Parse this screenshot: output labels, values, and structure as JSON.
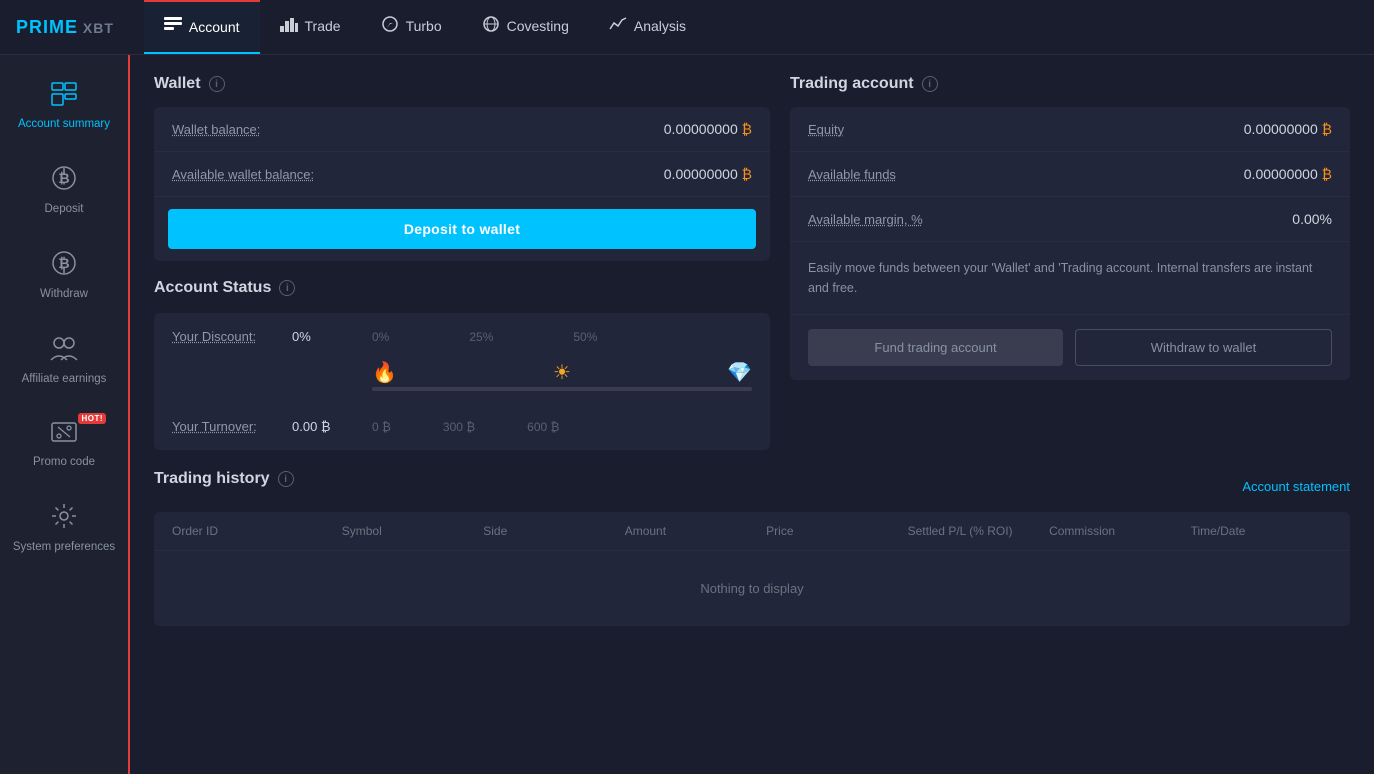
{
  "logo": {
    "prime": "PRIME",
    "xbt": " XBT"
  },
  "nav": {
    "items": [
      {
        "id": "account",
        "label": "Account",
        "icon": "🗂",
        "active": true
      },
      {
        "id": "trade",
        "label": "Trade",
        "icon": "📊",
        "active": false
      },
      {
        "id": "turbo",
        "label": "Turbo",
        "icon": "🔄",
        "active": false
      },
      {
        "id": "covesting",
        "label": "Covesting",
        "icon": "🌐",
        "active": false
      },
      {
        "id": "analysis",
        "label": "Analysis",
        "icon": "📈",
        "active": false
      }
    ]
  },
  "sidebar": {
    "items": [
      {
        "id": "account-summary",
        "label": "Account summary",
        "icon": "📋",
        "active": true
      },
      {
        "id": "deposit",
        "label": "Deposit",
        "icon": "₿↓",
        "active": false
      },
      {
        "id": "withdraw",
        "label": "Withdraw",
        "icon": "₿↑",
        "active": false
      },
      {
        "id": "affiliate-earnings",
        "label": "Affiliate earnings",
        "icon": "👥",
        "active": false
      },
      {
        "id": "promo-code",
        "label": "Promo code",
        "icon": "🏷",
        "active": false,
        "hot": true
      },
      {
        "id": "system-preferences",
        "label": "System preferences",
        "icon": "⚙",
        "active": false
      }
    ]
  },
  "wallet": {
    "title": "Wallet",
    "balance_label": "Wallet balance:",
    "balance_value": "0.00000000",
    "available_label": "Available wallet balance:",
    "available_value": "0.00000000",
    "btc_symbol": "₿",
    "deposit_btn": "Deposit to wallet"
  },
  "account_status": {
    "title": "Account Status",
    "discount_label": "Your Discount:",
    "discount_value": "0%",
    "tiers": [
      "0%",
      "25%",
      "50%"
    ],
    "turnover_label": "Your Turnover:",
    "turnover_value": "0.00",
    "turnover_tiers": [
      "0 ₿",
      "300 ₿",
      "600 ₿"
    ]
  },
  "trading_account": {
    "title": "Trading account",
    "equity_label": "Equity",
    "equity_value": "0.00000000",
    "available_funds_label": "Available funds",
    "available_funds_value": "0.00000000",
    "margin_label": "Available margin, %",
    "margin_value": "0.00%",
    "info_text": "Easily move funds between your 'Wallet' and 'Trading account. Internal transfers are instant and free.",
    "fund_btn": "Fund trading account",
    "withdraw_btn": "Withdraw to wallet",
    "btc_symbol": "₿"
  },
  "trading_history": {
    "title": "Trading history",
    "account_statement": "Account statement",
    "columns": [
      "Order ID",
      "Symbol",
      "Side",
      "Amount",
      "Price",
      "Settled P/L (% ROI)",
      "Commission",
      "Time/Date"
    ],
    "empty_message": "Nothing to display"
  }
}
